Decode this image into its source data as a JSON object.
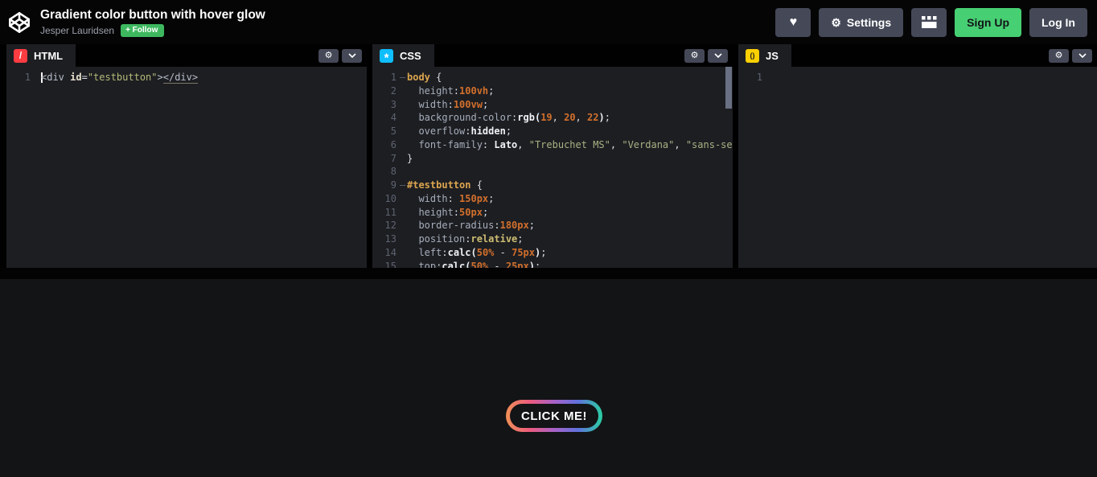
{
  "header": {
    "title": "Gradient color button with hover glow",
    "author": "Jesper Lauridsen",
    "follow": "+ Follow",
    "settings": "Settings",
    "sign_up": "Sign Up",
    "log_in": "Log In"
  },
  "icons": {
    "logo": "codepen-cube",
    "heart": "♥",
    "gear": "⚙",
    "chevron": "chevron-down",
    "layout": "view-switcher-grid",
    "html_glyph": "/",
    "css_glyph": "*",
    "js_glyph": "()"
  },
  "colors": {
    "accent_green": "#47cf73",
    "follow_green": "#3db85f",
    "button_gray": "#444857",
    "html_icon": "#ff3c41",
    "css_icon": "#0ebeff",
    "js_icon": "#fcd000",
    "editor_bg": "#1d1e22",
    "preview_bg": "#131416",
    "button_gradient": [
      "#f09056",
      "#ec5b7e",
      "#a862c8",
      "#5f71dd",
      "#2ad0a2"
    ]
  },
  "editors": {
    "html": {
      "label": "HTML",
      "lines": [
        {
          "num": 1,
          "cursor": true,
          "tokens": [
            {
              "t": "<div ",
              "c": "tag"
            },
            {
              "t": "id",
              "c": "attr"
            },
            {
              "t": "=",
              "c": "brace"
            },
            {
              "t": "\"testbutton\"",
              "c": "attrval"
            },
            {
              "t": ">",
              "c": "tag"
            },
            {
              "t": "</div>",
              "c": "tagu"
            }
          ]
        }
      ]
    },
    "css": {
      "label": "CSS",
      "lines": [
        {
          "num": 1,
          "fold": true,
          "tokens": [
            {
              "t": "body ",
              "c": "sel"
            },
            {
              "t": "{",
              "c": "brace"
            }
          ]
        },
        {
          "num": 2,
          "tokens": [
            {
              "t": "  height",
              "c": "prop"
            },
            {
              "t": ":",
              "c": "brace"
            },
            {
              "t": "100vh",
              "c": "num"
            },
            {
              "t": ";",
              "c": "brace"
            }
          ]
        },
        {
          "num": 3,
          "tokens": [
            {
              "t": "  width",
              "c": "prop"
            },
            {
              "t": ":",
              "c": "brace"
            },
            {
              "t": "100vw",
              "c": "num"
            },
            {
              "t": ";",
              "c": "brace"
            }
          ]
        },
        {
          "num": 4,
          "tokens": [
            {
              "t": "  background-color",
              "c": "prop"
            },
            {
              "t": ":",
              "c": "brace"
            },
            {
              "t": "rgb(",
              "c": "fn"
            },
            {
              "t": "19",
              "c": "num"
            },
            {
              "t": ", ",
              "c": "brace"
            },
            {
              "t": "20",
              "c": "num"
            },
            {
              "t": ", ",
              "c": "brace"
            },
            {
              "t": "22",
              "c": "num"
            },
            {
              "t": ")",
              "c": "fn"
            },
            {
              "t": ";",
              "c": "brace"
            }
          ]
        },
        {
          "num": 5,
          "tokens": [
            {
              "t": "  overflow",
              "c": "prop"
            },
            {
              "t": ":",
              "c": "brace"
            },
            {
              "t": "hidden",
              "c": "kw"
            },
            {
              "t": ";",
              "c": "brace"
            }
          ]
        },
        {
          "num": 6,
          "tokens": [
            {
              "t": "  font-family",
              "c": "prop"
            },
            {
              "t": ": ",
              "c": "brace"
            },
            {
              "t": "Lato",
              "c": "kw"
            },
            {
              "t": ", ",
              "c": "brace"
            },
            {
              "t": "\"Trebuchet MS\"",
              "c": "str"
            },
            {
              "t": ", ",
              "c": "brace"
            },
            {
              "t": "\"Verdana\"",
              "c": "str"
            },
            {
              "t": ", ",
              "c": "brace"
            },
            {
              "t": "\"sans-serif\"",
              "c": "str"
            },
            {
              "t": ";",
              "c": "brace"
            }
          ]
        },
        {
          "num": 7,
          "tokens": [
            {
              "t": "}",
              "c": "brace"
            }
          ]
        },
        {
          "num": 8,
          "tokens": []
        },
        {
          "num": 9,
          "fold": true,
          "tokens": [
            {
              "t": "#testbutton ",
              "c": "sel"
            },
            {
              "t": "{",
              "c": "brace"
            }
          ]
        },
        {
          "num": 10,
          "tokens": [
            {
              "t": "  width",
              "c": "prop"
            },
            {
              "t": ": ",
              "c": "brace"
            },
            {
              "t": "150px",
              "c": "num"
            },
            {
              "t": ";",
              "c": "brace"
            }
          ]
        },
        {
          "num": 11,
          "tokens": [
            {
              "t": "  height",
              "c": "prop"
            },
            {
              "t": ":",
              "c": "brace"
            },
            {
              "t": "50px",
              "c": "num"
            },
            {
              "t": ";",
              "c": "brace"
            }
          ]
        },
        {
          "num": 12,
          "tokens": [
            {
              "t": "  border-radius",
              "c": "prop"
            },
            {
              "t": ":",
              "c": "brace"
            },
            {
              "t": "180px",
              "c": "num"
            },
            {
              "t": ";",
              "c": "brace"
            }
          ]
        },
        {
          "num": 13,
          "tokens": [
            {
              "t": "  position",
              "c": "prop"
            },
            {
              "t": ":",
              "c": "brace"
            },
            {
              "t": "relative",
              "c": "kw2"
            },
            {
              "t": ";",
              "c": "brace"
            }
          ]
        },
        {
          "num": 14,
          "tokens": [
            {
              "t": "  left",
              "c": "prop"
            },
            {
              "t": ":",
              "c": "brace"
            },
            {
              "t": "calc(",
              "c": "fn"
            },
            {
              "t": "50%",
              "c": "num"
            },
            {
              "t": " - ",
              "c": "brace"
            },
            {
              "t": "75px",
              "c": "num"
            },
            {
              "t": ")",
              "c": "fn"
            },
            {
              "t": ";",
              "c": "brace"
            }
          ]
        },
        {
          "num": 15,
          "tokens": [
            {
              "t": "  top",
              "c": "prop"
            },
            {
              "t": ":",
              "c": "brace"
            },
            {
              "t": "calc(",
              "c": "fn"
            },
            {
              "t": "50%",
              "c": "num"
            },
            {
              "t": " - ",
              "c": "brace"
            },
            {
              "t": "25px",
              "c": "num"
            },
            {
              "t": ")",
              "c": "fn"
            },
            {
              "t": ";",
              "c": "brace"
            }
          ]
        }
      ]
    },
    "js": {
      "label": "JS",
      "lines": [
        {
          "num": 1,
          "tokens": []
        }
      ]
    }
  },
  "preview": {
    "button_label": "CLICK ME!"
  }
}
